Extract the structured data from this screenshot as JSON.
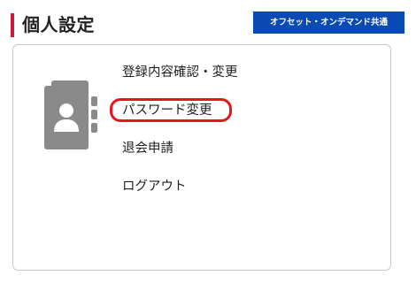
{
  "header": {
    "title": "個人設定",
    "badge": "オフセット・オンデマンド共通"
  },
  "menu": {
    "items": [
      {
        "label": "登録内容確認・変更",
        "highlighted": false
      },
      {
        "label": "パスワード変更",
        "highlighted": true
      },
      {
        "label": "退会申請",
        "highlighted": false
      },
      {
        "label": "ログアウト",
        "highlighted": false
      }
    ]
  },
  "icons": {
    "profile": "address-book-icon"
  },
  "colors": {
    "accent_red": "#cc1a3a",
    "badge_blue": "#0a4ab3",
    "highlight_ring": "#e8141e",
    "icon_gray": "#8a8a8a"
  }
}
